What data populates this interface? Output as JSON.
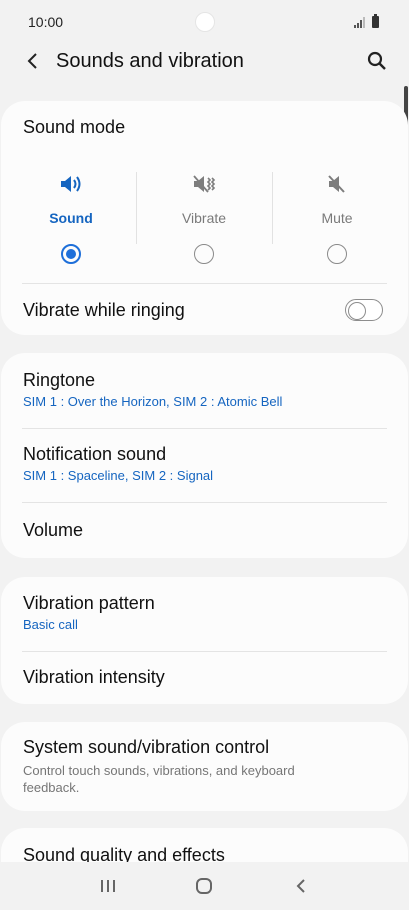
{
  "status": {
    "time": "10:00"
  },
  "header": {
    "title": "Sounds and vibration"
  },
  "sound_mode": {
    "title": "Sound mode",
    "options": [
      {
        "label": "Sound",
        "icon": "speaker-icon",
        "selected": true
      },
      {
        "label": "Vibrate",
        "icon": "vibrate-icon",
        "selected": false
      },
      {
        "label": "Mute",
        "icon": "mute-icon",
        "selected": false
      }
    ],
    "vibrate_while_ringing": {
      "label": "Vibrate while ringing",
      "on": false
    }
  },
  "ringtone": {
    "title": "Ringtone",
    "value": "SIM 1 : Over the Horizon, SIM 2 : Atomic Bell"
  },
  "notification_sound": {
    "title": "Notification sound",
    "value": "SIM 1 : Spaceline, SIM 2 : Signal"
  },
  "volume": {
    "title": "Volume"
  },
  "vibration_pattern": {
    "title": "Vibration pattern",
    "value": "Basic call"
  },
  "vibration_intensity": {
    "title": "Vibration intensity"
  },
  "system_sound": {
    "title": "System sound/vibration control",
    "desc": "Control touch sounds, vibrations, and keyboard feedback."
  },
  "sound_quality": {
    "title": "Sound quality and effects"
  },
  "colors": {
    "accent": "#1565c0",
    "radio": "#1e6fd9",
    "background": "#f2f2f2",
    "card": "#fcfcfc"
  }
}
